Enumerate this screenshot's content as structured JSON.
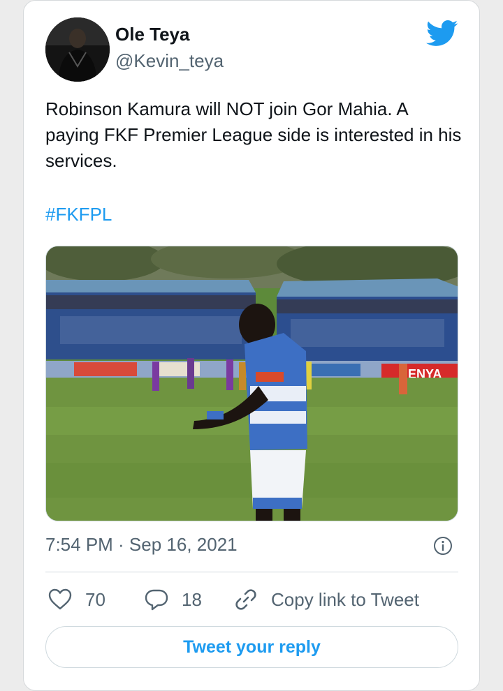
{
  "tweet": {
    "author": {
      "name": "Ole Teya",
      "handle": "@Kevin_teya"
    },
    "text": "Robinson Kamura will NOT join Gor Mahia. A paying FKF Premier League side is interested in his services.",
    "hashtag": "#FKFPL",
    "timestamp": "7:54 PM · Sep 16, 2021",
    "likes": "70",
    "replies": "18",
    "copy_link_label": "Copy link to Tweet",
    "reply_button_label": "Tweet your reply",
    "media_banner_text": "ENYA"
  },
  "icons": {
    "brand": "twitter-bird-icon",
    "info": "info-icon",
    "like": "heart-icon",
    "reply": "speech-bubble-icon",
    "copy": "link-icon"
  },
  "colors": {
    "accent": "#1d9bf0",
    "text": "#0f1419",
    "secondary": "#536471",
    "border": "#cfd9de"
  }
}
